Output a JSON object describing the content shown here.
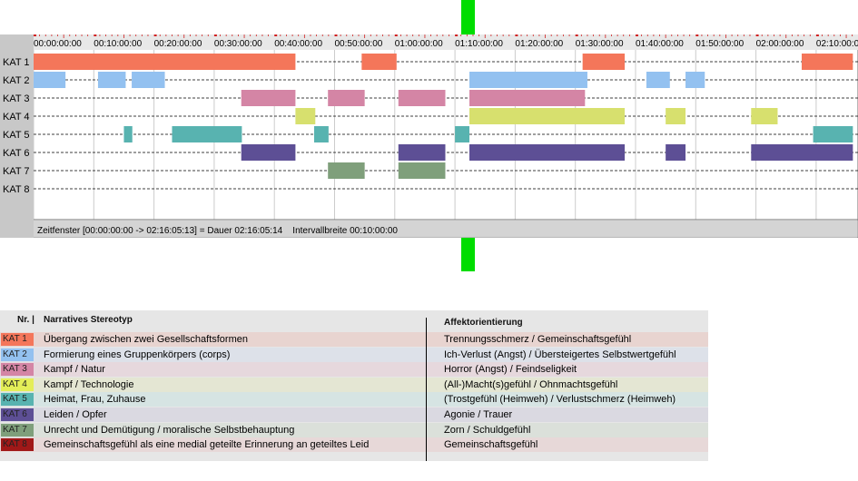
{
  "timeline": {
    "time_labels": [
      "00:00:00:00",
      "00:10:00:00",
      "00:20:00:00",
      "00:30:00:00",
      "00:40:00:00",
      "00:50:00:00",
      "01:00:00:00",
      "01:10:00:00",
      "01:20:00:00",
      "01:30:00:00",
      "01:40:00:00",
      "01:50:00:00",
      "02:00:00:00",
      "02:10:00:00"
    ],
    "rows": [
      {
        "label": "KAT 1",
        "color": "#f4765a",
        "segments": [
          [
            0,
            43.5
          ],
          [
            54.5,
            60.3
          ],
          [
            91.2,
            98.2
          ],
          [
            127.6,
            136.1
          ]
        ]
      },
      {
        "label": "KAT 2",
        "color": "#93c1f0",
        "segments": [
          [
            0,
            5.3
          ],
          [
            10.7,
            15.3
          ],
          [
            16.3,
            21.8
          ],
          [
            72.4,
            92
          ],
          [
            101.8,
            105.7
          ],
          [
            108.3,
            111.5
          ]
        ]
      },
      {
        "label": "KAT 3",
        "color": "#d485a5",
        "segments": [
          [
            34.5,
            43.5
          ],
          [
            48.9,
            55
          ],
          [
            60.6,
            68.4
          ],
          [
            72.4,
            91.6
          ]
        ]
      },
      {
        "label": "KAT 4",
        "color": "#d7e06e",
        "segments": [
          [
            43.5,
            46.8
          ],
          [
            72.4,
            98.2
          ],
          [
            105,
            108.3
          ],
          [
            119.2,
            123.6
          ]
        ]
      },
      {
        "label": "KAT 5",
        "color": "#58b3b0",
        "segments": [
          [
            15,
            16.4
          ],
          [
            23,
            34.6
          ],
          [
            46.6,
            49
          ],
          [
            70,
            72.4
          ],
          [
            129.5,
            136.1
          ]
        ]
      },
      {
        "label": "KAT 6",
        "color": "#5d4f95",
        "segments": [
          [
            34.5,
            43.5
          ],
          [
            60.6,
            68.4
          ],
          [
            72.4,
            98.2
          ],
          [
            105,
            108.3
          ],
          [
            119.2,
            136.1
          ]
        ]
      },
      {
        "label": "KAT 7",
        "color": "#7f9f7b",
        "segments": [
          [
            48.9,
            55
          ],
          [
            60.6,
            68.4
          ]
        ]
      },
      {
        "label": "KAT 8",
        "color": "#8b1a1a",
        "segments": []
      }
    ],
    "status": "Zeitfenster [00:00:00:00 -> 02:16:05:13] = Dauer 02:16:05:14    Intervallbreite 00:10:00:00"
  },
  "legend": {
    "headers": {
      "nr": "Nr. |",
      "narrative": "Narratives Stereotyp",
      "affekt": "Affektorientierung"
    },
    "rows": [
      {
        "code": "KAT 1",
        "narrative": "Übergang zwischen zwei Gesellschaftsformen",
        "affekt": "Trennungsschmerz / Gemeinschaftsgefühl",
        "color": "#f4765a",
        "band": "#e8d4d0"
      },
      {
        "code": "KAT 2",
        "narrative": "Formierung eines Gruppenkörpers (corps)",
        "affekt": "Ich-Verlust (Angst) / Übersteigertes Selbstwertgefühl",
        "color": "#93c1f0",
        "band": "#dde1e9"
      },
      {
        "code": "KAT 3",
        "narrative": "Kampf / Natur",
        "affekt": "Horror (Angst) / Feindseligkeit",
        "color": "#d485a5",
        "band": "#e6d8dd"
      },
      {
        "code": "KAT 4",
        "narrative": "Kampf / Technologie",
        "affekt": "(All-)Macht(s)gefühl / Ohnmachtsgefühl",
        "color": "#e4ee58",
        "band": "#e4e6d3"
      },
      {
        "code": "KAT 5",
        "narrative": "Heimat, Frau, Zuhause",
        "affekt": "(Trostgefühl (Heimweh) / Verlustschmerz (Heimweh)",
        "color": "#58b3b0",
        "band": "#d6e4e3"
      },
      {
        "code": "KAT 6",
        "narrative": "Leiden / Opfer",
        "affekt": "Agonie / Trauer",
        "color": "#5d4f95",
        "band": "#dad9e1"
      },
      {
        "code": "KAT 7",
        "narrative": "Unrecht und Demütigung / moralische Selbstbehauptung",
        "affekt": "Zorn / Schuldgefühl",
        "color": "#7f9f7b",
        "band": "#dbe0da"
      },
      {
        "code": "KAT 8",
        "narrative": "Gemeinschaftsgefühl als eine medial geteilte Erinnerung an geteiltes Leid",
        "affekt": "Gemeinschaftsgefühl",
        "color": "#a01818",
        "band": "#e7d8d8"
      }
    ]
  },
  "colors": {
    "cursor_line": "#00dd00",
    "grid_dashes": "#000000",
    "row_header_bg": "#c8c8c8"
  }
}
